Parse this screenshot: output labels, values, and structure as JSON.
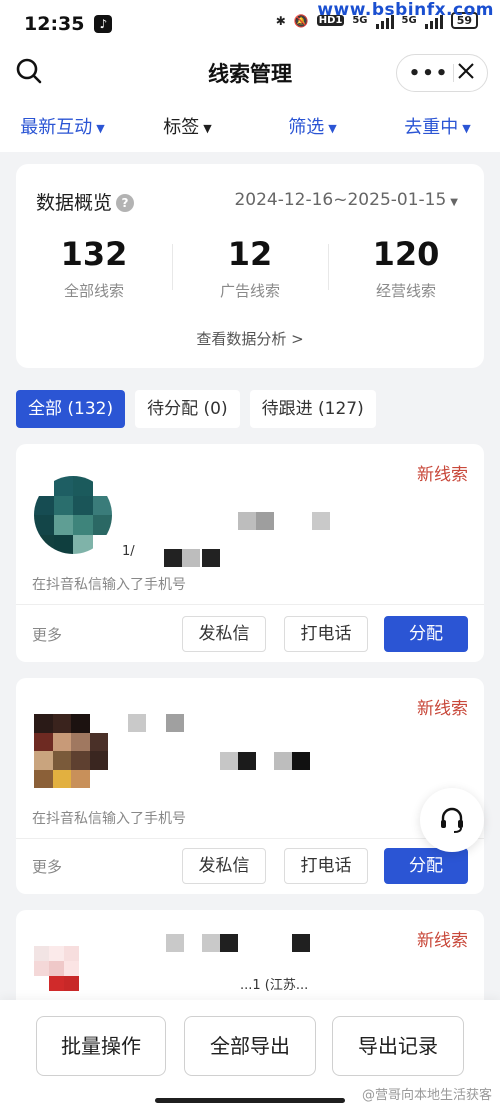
{
  "status": {
    "time": "12:35",
    "battery": "59",
    "net1": "HD1",
    "net2": "5G",
    "net3": "5G"
  },
  "watermark_top": "www.bsbinfx.com",
  "header": {
    "title": "线索管理"
  },
  "filters": [
    {
      "label": "最新互动",
      "color": "#2b55d4"
    },
    {
      "label": "标签",
      "color": "#1f1f1f"
    },
    {
      "label": "筛选",
      "color": "#2b55d4"
    },
    {
      "label": "去重中",
      "color": "#2b55d4"
    }
  ],
  "overview": {
    "title": "数据概览",
    "date_range": "2024-12-16~2025-01-15",
    "stats": [
      {
        "value": "132",
        "label": "全部线索"
      },
      {
        "value": "12",
        "label": "广告线索"
      },
      {
        "value": "120",
        "label": "经营线索"
      }
    ],
    "link": "查看数据分析 >"
  },
  "tabs": [
    {
      "label": "全部 (132)",
      "active": true
    },
    {
      "label": "待分配 (0)",
      "active": false
    },
    {
      "label": "待跟进 (127)",
      "active": false
    }
  ],
  "cards": [
    {
      "badge": "新线索",
      "note": "在抖音私信输入了手机号",
      "more": "更多",
      "actions": [
        "发私信",
        "打电话",
        "分配"
      ],
      "fragment": "1/"
    },
    {
      "badge": "新线索",
      "note": "在抖音私信输入了手机号",
      "more": "更多",
      "actions": [
        "发私信",
        "打电话",
        "分配"
      ]
    },
    {
      "badge": "新线索",
      "fragment": "...1 (江苏..."
    }
  ],
  "bottom": {
    "batch": "批量操作",
    "export_all": "全部导出",
    "export_log": "导出记录"
  },
  "watermark_bottom": "@营哥向本地生活获客",
  "colors": {
    "accent": "#2b55d4",
    "badge": "#c8483a"
  }
}
